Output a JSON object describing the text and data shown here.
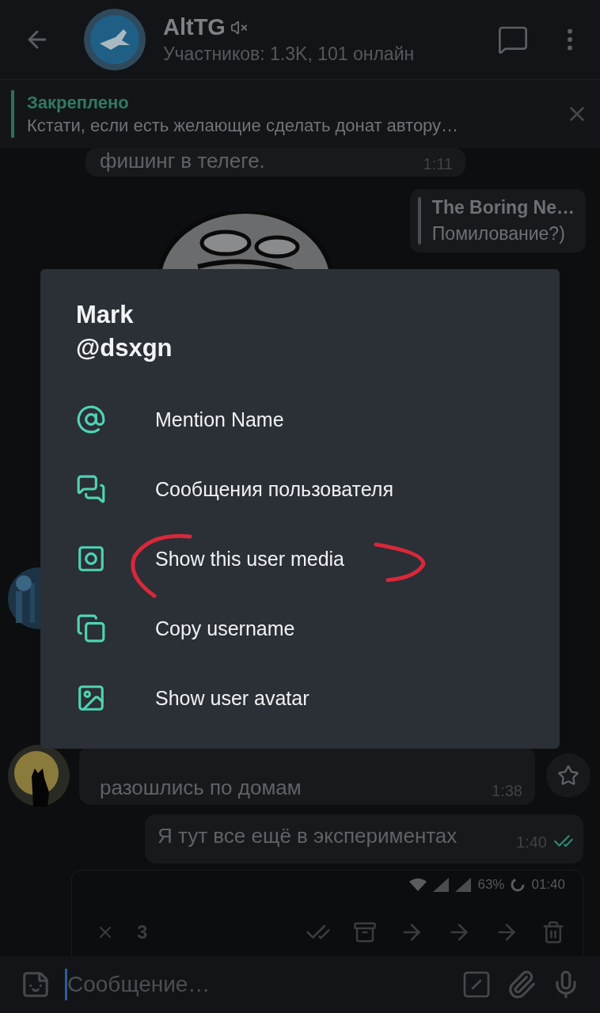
{
  "header": {
    "title": "AltTG",
    "muted": true,
    "subtitle": "Участников: 1.3K, 101 онлайн"
  },
  "pinned": {
    "label": "Закреплено",
    "text": "Кстати, если есть желающие сделать донат автору…"
  },
  "message_top": {
    "text": "фишинг в телеге.",
    "time": "1:11"
  },
  "reply_message": {
    "sender": "The Boring Ne…",
    "text": "Помилование?)"
  },
  "message_cat": {
    "text": "разошлись по домам",
    "time": "1:38"
  },
  "message_out": {
    "text": "Я тут все ещё в экспериментах",
    "time": "1:40",
    "read": true
  },
  "screenshot": {
    "battery": "63%",
    "clock": "01:40",
    "count": "3"
  },
  "dialog": {
    "name": "Mark",
    "username": "@dsxgn",
    "items": [
      {
        "kind": "mention",
        "label": "Mention Name"
      },
      {
        "kind": "messages",
        "label": "Сообщения пользователя"
      },
      {
        "kind": "media",
        "label": "Show this user media"
      },
      {
        "kind": "copy",
        "label": "Copy username"
      },
      {
        "kind": "avatar",
        "label": "Show user avatar"
      }
    ]
  },
  "composer": {
    "placeholder": "Сообщение…"
  }
}
